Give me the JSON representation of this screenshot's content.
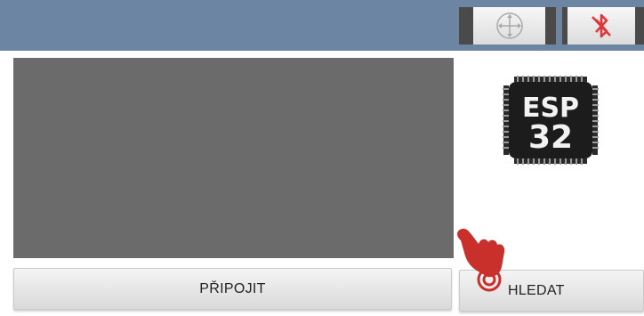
{
  "toolbar": {
    "compass_icon": "crosshair-circle-icon",
    "bluetooth_icon": "bluetooth-disabled-icon",
    "bluetooth_color": "#e0373c"
  },
  "chip": {
    "line1": "ESP",
    "line2": "32"
  },
  "buttons": {
    "connect_label": "PŘIPOJIT",
    "search_label": "HLEDAT"
  },
  "colors": {
    "topbar": "#6b85a2",
    "panel": "#6b6b6b",
    "hand": "#c9302c"
  }
}
